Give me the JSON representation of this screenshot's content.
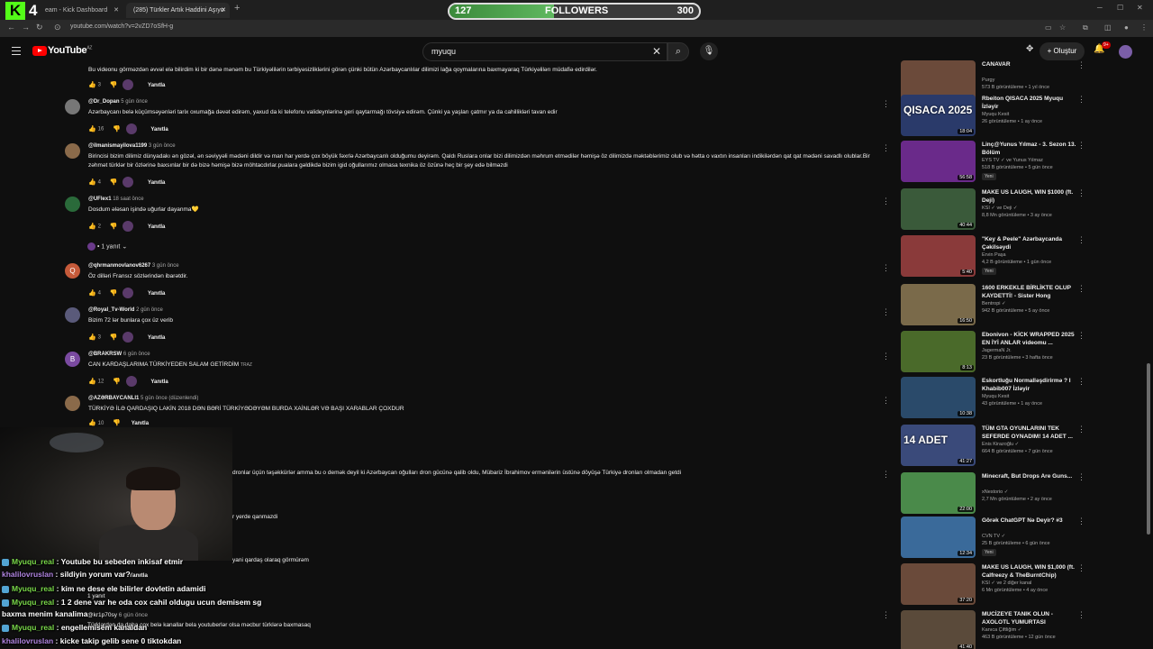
{
  "browser": {
    "tabs": [
      {
        "label": "eam - Kick Dashboard"
      },
      {
        "label": "(285) Türkler Artık Haddini Aşıyo"
      }
    ],
    "url": "youtube.com/watch?v=2vZD7oSfH-g"
  },
  "overlay": {
    "kick_number": "4",
    "followers_label": "FOLLOWERS",
    "followers_current": "127",
    "followers_goal": "300",
    "followers_progress": 0.42
  },
  "header": {
    "logo_text": "YouTube",
    "region": "AZ",
    "search_value": "myuqu",
    "create_label": "Oluştur",
    "notif_badge": "9+"
  },
  "comments": [
    {
      "author": "",
      "time": "",
      "text": "Bu videonu görməzdən əvvəl elə bilirdim ki bir dənə mənəm bu Türkiyəlilərin tərbiyəsizliklərini görən çünki bütün Azərbaycanlılar dilimizi lağa qoymalarına baxmayaraq Türkiyəlilərı müdafiə edirdilər.",
      "likes": "3",
      "reply": "Yanıtla"
    },
    {
      "author": "@Dr_Dopan",
      "time": "5 gün önce",
      "text": "Azərbaycanı belə küçümsəyənləri tarix oxumağa dəvət edirəm, yaxud da ki telefonu valideynlərinə geri qaytarmağı tövsiyə edirəm. Çünki ya yaşları çatmır ya da cahillikləri tavan edir",
      "likes": "16",
      "reply": "Yanıtla"
    },
    {
      "author": "@ilmanismayilova1199",
      "time": "3 gün önce",
      "text": "Birincisi bizim dilimiz dünyadakı ən gözəl, ən səviyyəli mədəni dildir və man har yerdə çox böyük fəxrlə Azərbaycanlı olduğumu deyirəm. Qaldı Ruslara onlar bizi dilimizdən məhrum etmədilər həmişə öz dilimizdə məktəblərimiz olub və hətta o vaxtın insanları indikilərdən qat qat mədəni savadlı olublar.Bir zəhmət türklər bir özlərinə baxsınlar bir də bizə həmişə bizə möhtacdırlar.pualara gəldikdə bizim igid oğullarımız olmasa texnika öz özünə heç bir şey edə bilməzdi",
      "likes": "4",
      "reply": "Yanıtla"
    },
    {
      "author": "@UFlex1",
      "time": "18 saat önce",
      "text": "Dosdum ələsan işində uğurlar dayanma💛",
      "likes": "2",
      "reply": "Yanıtla",
      "replies_label": "1 yanıt"
    },
    {
      "author": "@qhrmanmovlanov6267",
      "time": "3 gün önce",
      "text": "Öz dilləri Fransız sözlərindən ibarətdir.",
      "likes": "4",
      "reply": "Yanıtla"
    },
    {
      "author": "@Royal_Tv-World",
      "time": "2 gün önce",
      "text": "Bizim 72 lər bunlara çox üz verib",
      "likes": "3",
      "reply": "Yanıtla"
    },
    {
      "author": "@BRAKRSW",
      "time": "6 gün önce",
      "text": "CAN KARDAŞLARIMA TÜRKİYEDEN SALAM GETİRDİM",
      "translate": "TRAZ",
      "likes": "12",
      "reply": "Yanıtla"
    },
    {
      "author": "@AZƏRBAYCANLI1",
      "time": "5 gün önce (düzenlendi)",
      "text": "TÜRKİYƏ İLƏ QARDAŞIQ LAKİN 2018 DƏN BƏRİ TÜRKİYƏDƏYƏM BURDA XAİNLƏR VƏ BAŞI XARABLAR ÇOXDUR",
      "likes": "10",
      "reply": "Yanıtla"
    }
  ],
  "peek_texts": [
    "dronlar üçün təşəkkürlər amma bu o demək deyil ki Azərbaycan oğulları dron gücünə qalib oldu, Mübariz İbrahimov ermənilərin üstünə döyüşə Türkiyə dronları olmadan getdi",
    "r yerde qanmazdi",
    "yani qardaş olaraq görmürəm",
    "Yanıtla",
    "1 yanıt",
    "@kr1p70sy",
    "6 gün önce",
    "Türklərdən da daha çox belə kanallar bela youtuberlər olsa məcbur türklərə baxmasaq"
  ],
  "chat": [
    {
      "user": "Myuqu_real",
      "msg": "Youtube bu sebeden inkisaf etmir",
      "kind": "u1"
    },
    {
      "user": "khalilovruslan",
      "msg": "sildiyin yorum var?",
      "kind": "u2"
    },
    {
      "user": "Myuqu_real",
      "msg": "kim ne dese ele bilirler dovletin adamidi",
      "kind": "u1"
    },
    {
      "user": "Myuqu_real",
      "msg": "1 2 dene var he oda cox cahil oldugu ucun demisem sg",
      "kind": "u1"
    },
    {
      "user": "",
      "msg": "baxma menim kanalima",
      "kind": "u1"
    },
    {
      "user": "Myuqu_real",
      "msg": "engellemisem kanaldan",
      "kind": "u1"
    },
    {
      "user": "khalilovruslan",
      "msg": "kicke takip gelib sene 0 tiktokdan",
      "kind": "u2"
    }
  ],
  "sidebar_videos": [
    {
      "title": "CANAVAR",
      "channel": "Purgy",
      "meta": "573 B görüntüleme • 1 yıl önce",
      "duration": "28:35",
      "thumb_color": "#6b4a3a",
      "thumb_text": ""
    },
    {
      "title": "Rbeiton QISACA 2025 Myuqu İzləyir",
      "channel": "Myuqu Kesit",
      "meta": "26 görüntüleme • 1 ay önce",
      "duration": "18:04",
      "thumb_color": "#2a3a6a",
      "thumb_text": "QISACA 2025"
    },
    {
      "title": "Linç@Yunus Yılmaz - 3. Sezon 13. Bölüm",
      "channel": "EYS TV ✓ ve Yunus Yılmaz",
      "meta": "518 B görüntüleme • 5 gün önce",
      "duration": "56:58",
      "thumb_color": "#6a2a8a",
      "thumb_text": "",
      "badge": "Yeni"
    },
    {
      "title": "MAKE US LAUGH, WIN $1000 (ft. Deji)",
      "channel": "KSI ✓ ve Deji ✓",
      "meta": "8,8 Mn görüntüleme • 3 ay önce",
      "duration": "40:44",
      "thumb_color": "#3a5a3a",
      "thumb_text": ""
    },
    {
      "title": "\"Key & Peele\" Azərbaycanda Çəkilsəydi",
      "channel": "Ervin Paşa",
      "meta": "4,2 B görüntüleme • 1 gün önce",
      "duration": "5:40",
      "thumb_color": "#8a3a3a",
      "thumb_text": "",
      "badge": "Yeni"
    },
    {
      "title": "1600 ERKEKLE BİRLİKTE OLUP KAYDETTİ! - Sister Hong",
      "channel": "Bentropi ✓",
      "meta": "942 B görüntüleme • 5 ay önce",
      "duration": "16:50",
      "thumb_color": "#7a6a4a",
      "thumb_text": ""
    },
    {
      "title": "Ebonivon - KİCK WRAPPED 2025 EN İYİ ANLAR videomu ...",
      "channel": "JagermaN Jr.",
      "meta": "23 B görüntüleme • 3 hafta önce",
      "duration": "8:13",
      "thumb_color": "#4a6a2a",
      "thumb_text": ""
    },
    {
      "title": "Eskortluğu Normalləşdirirmə ? I Khabib007 İzləyir",
      "channel": "Myuqu Kesit",
      "meta": "43 görüntüleme • 1 ay önce",
      "duration": "10:38",
      "thumb_color": "#2a4a6a",
      "thumb_text": ""
    },
    {
      "title": "TÜM GTA OYUNLARINI TEK SEFERDE OYNADIM! 14 ADET ...",
      "channel": "Enis Kirazoğlu ✓",
      "meta": "664 B görüntüleme • 7 gün önce",
      "duration": "41:27",
      "thumb_color": "#3a4a7a",
      "thumb_text": "14 ADET"
    },
    {
      "title": "Minecraft, But Drops Are Guns...",
      "channel": "xNestorio ✓",
      "meta": "2,7 Mn görüntüleme • 2 ay önce",
      "duration": "22:00",
      "thumb_color": "#4a8a4a",
      "thumb_text": ""
    },
    {
      "title": "Görək ChatGPT Nə Deyir? #3",
      "channel": "CVN TV ✓",
      "meta": "25 B görüntüleme • 6 gün önce",
      "duration": "12:34",
      "thumb_color": "#3a6a9a",
      "thumb_text": "",
      "badge": "Yeni"
    },
    {
      "title": "MAKE US LAUGH, WIN $1,000 (ft. Calfreezy & TheBurntChip)",
      "channel": "KSI ✓ ve 2 diğer kanal",
      "meta": "6 Mn görüntüleme • 4 ay önce",
      "duration": "37:20",
      "thumb_color": "#6a4a3a",
      "thumb_text": ""
    },
    {
      "title": "MUCİZEYE TANIK OLUN - AXOLOTL YUMURTASI",
      "channel": "Kanıca Çiftliğim ✓",
      "meta": "463 B görüntüleme • 12 gün önce",
      "duration": "41:40",
      "thumb_color": "#5a4a3a",
      "thumb_text": ""
    }
  ]
}
